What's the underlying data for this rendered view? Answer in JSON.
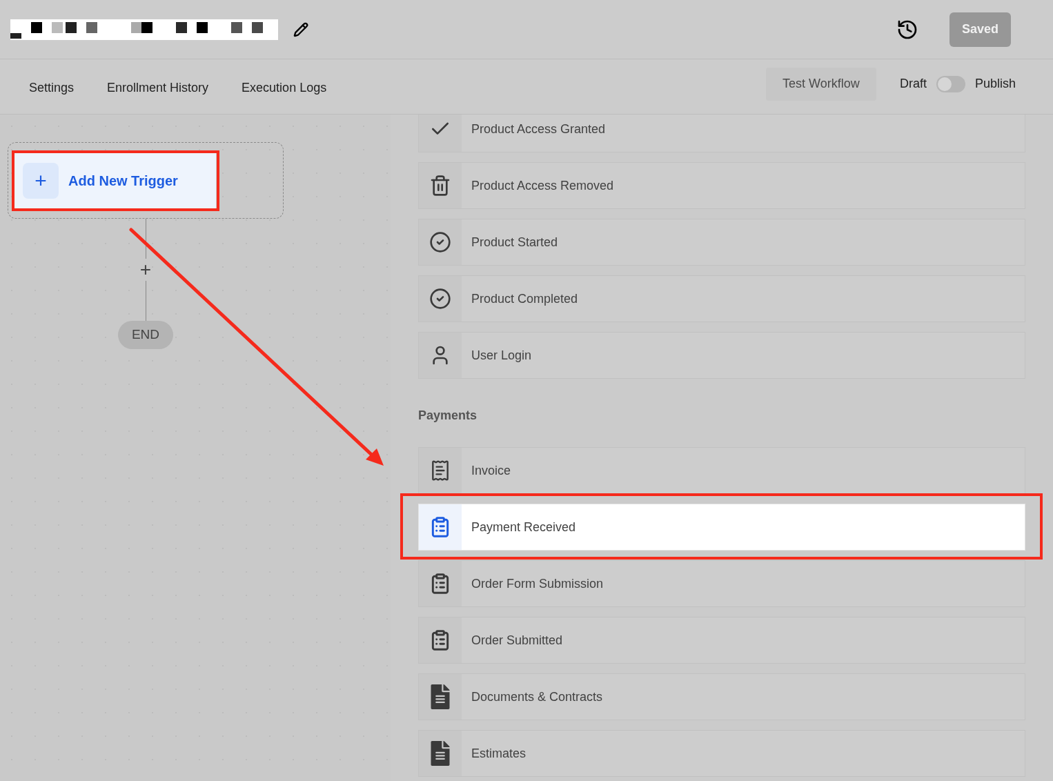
{
  "header": {
    "saved_button": "Saved"
  },
  "tabs": [
    {
      "label": "Settings",
      "selected": false
    },
    {
      "label": "Enrollment History",
      "selected": false
    },
    {
      "label": "Execution Logs",
      "selected": false
    }
  ],
  "test_button": "Test Workflow",
  "publish_toggle": {
    "off_label": "Draft",
    "on_label": "Publish",
    "on": false
  },
  "canvas": {
    "trigger_button": "+",
    "trigger_label": "Add New Trigger",
    "add_step": "+",
    "end_node": "END"
  },
  "trigger_groups": [
    {
      "items": [
        {
          "label": "Product Access Granted",
          "kind": "check",
          "selected": false
        },
        {
          "label": "Product Access Removed",
          "kind": "trash",
          "selected": false
        },
        {
          "label": "Product Started",
          "kind": "circle-check",
          "selected": false
        },
        {
          "label": "Product Completed",
          "kind": "circle-check",
          "selected": false
        },
        {
          "label": "User Login",
          "kind": "user",
          "selected": false
        }
      ]
    },
    {
      "title": "Payments",
      "items": [
        {
          "label": "Invoice",
          "kind": "invoice",
          "selected": false
        },
        {
          "label": "Payment Received",
          "kind": "clipboard",
          "selected": true
        },
        {
          "label": "Order Form Submission",
          "kind": "clipboard",
          "selected": false
        },
        {
          "label": "Order Submitted",
          "kind": "clipboard",
          "selected": false
        },
        {
          "label": "Documents & Contracts",
          "kind": "file",
          "selected": false
        },
        {
          "label": "Estimates",
          "kind": "file",
          "selected": false
        }
      ]
    }
  ]
}
